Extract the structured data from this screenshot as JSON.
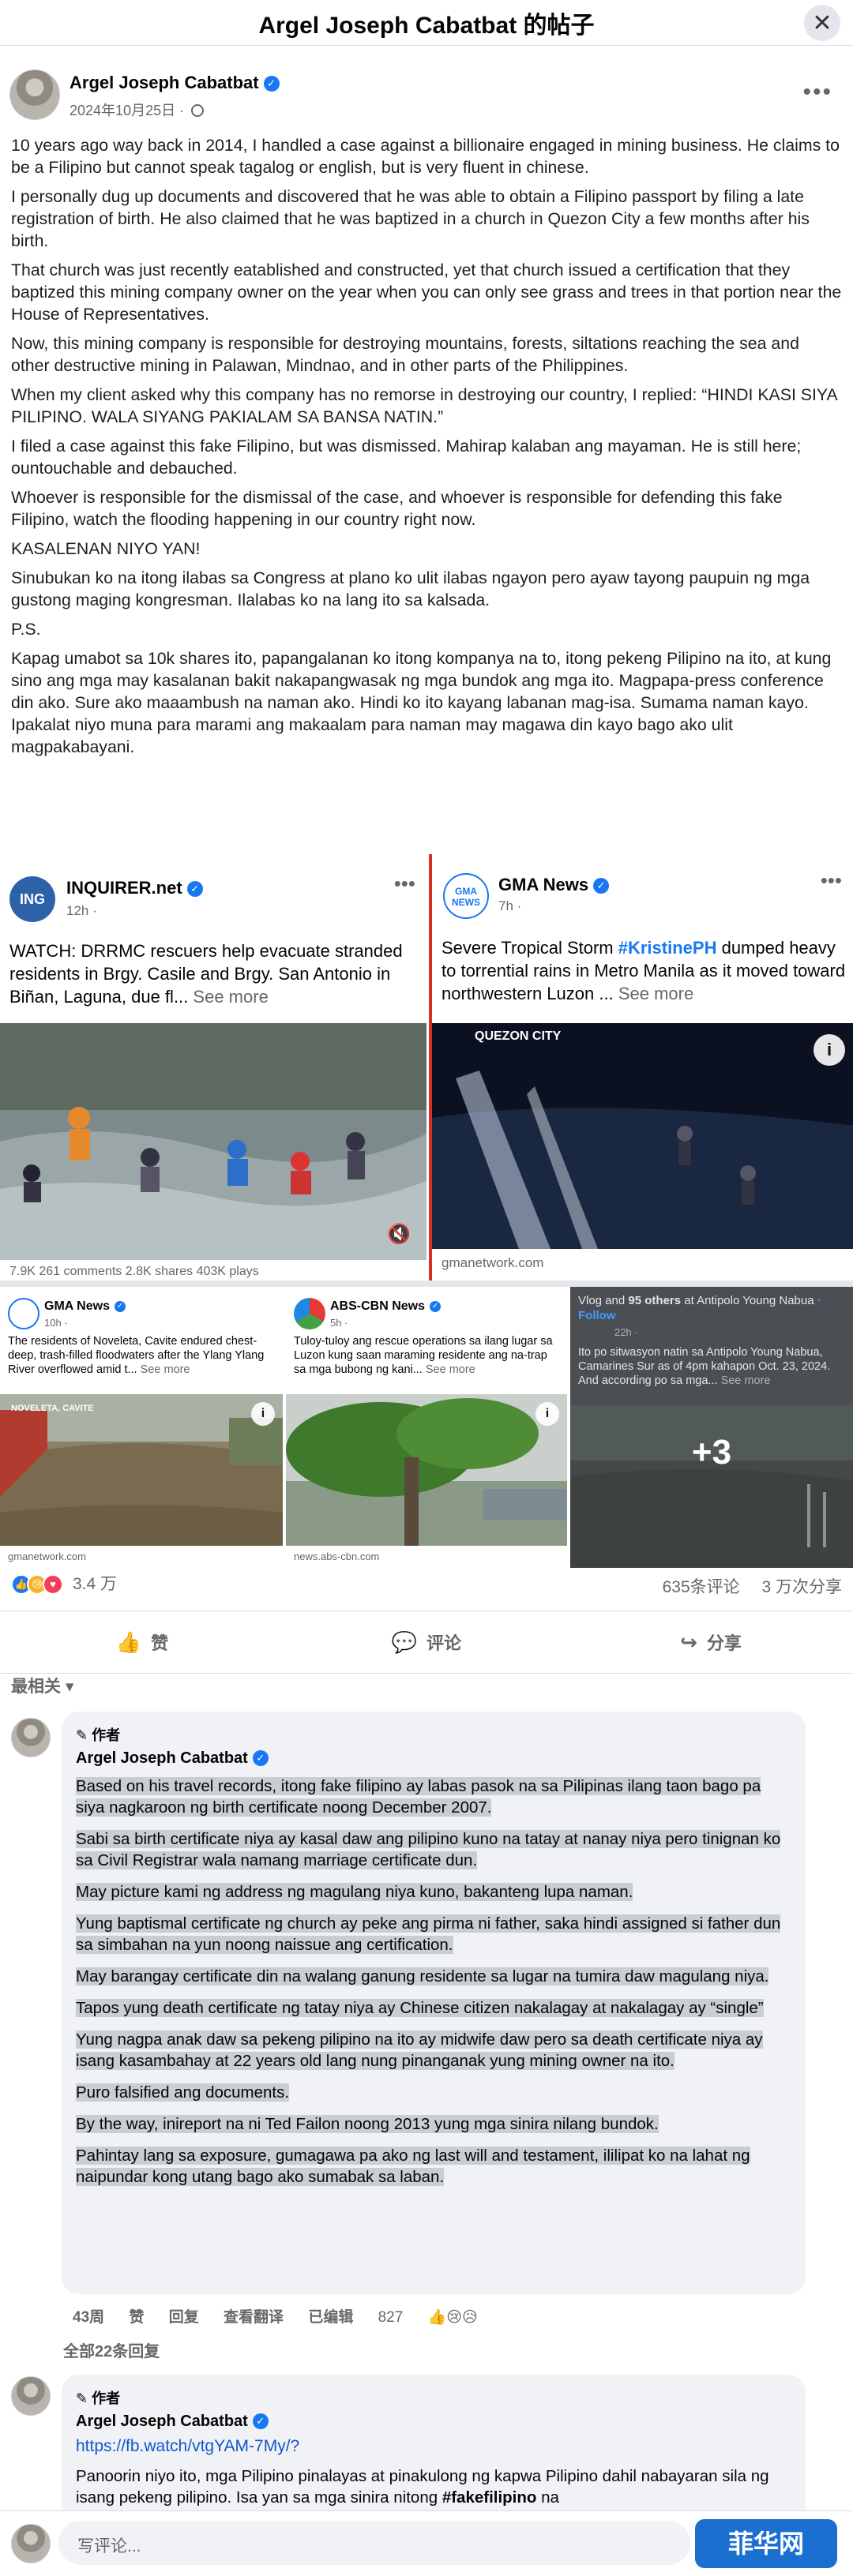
{
  "header": {
    "title": "Argel Joseph Cabatbat 的帖子",
    "close_icon": "close-icon"
  },
  "post": {
    "author": "Argel Joseph Cabatbat",
    "date": "2024年10月25日 ·",
    "paragraphs": [
      "10 years ago way back in 2014, I handled a case against a billionaire engaged in mining business. He claims to be a Filipino but cannot speak tagalog or english, but is very fluent in chinese.",
      "I personally dug up documents and discovered that he was able to obtain a Filipino passport by filing a late registration of birth. He also claimed that he was baptized in a church in Quezon City a few months after his birth.",
      "That church was just recently eatablished and constructed, yet that church issued a certification that they baptized this mining company owner on the year when you can only see grass and trees in that portion near the House of Representatives.",
      "Now, this mining company is responsible for destroying mountains, forests, siltations reaching the sea and other destructive mining in Palawan, Mindnao, and in other parts of the Philippines.",
      "When my client asked why this company has no remorse in destroying our country, I replied: “HINDI KASI SIYA PILIPINO. WALA SIYANG PAKIALAM SA BANSA NATIN.”",
      "I filed a case against this fake Filipino, but was dismissed. Mahirap kalaban ang mayaman. He is still here; ountouchable and debauched.",
      "Whoever is responsible for the dismissal of the case, and whoever is responsible for defending this fake Filipino, watch the flooding happening in our country right now.",
      "KASALENAN  NIYO YAN!",
      "Sinubukan ko na itong ilabas sa Congress at plano ko ulit ilabas ngayon pero ayaw tayong paupuin ng mga gustong maging kongresman. Ilalabas ko na lang ito sa kalsada.",
      "P.S.",
      "Kapag umabot sa 10k shares ito, papangalanan ko itong kompanya na to, itong pekeng Pilipino na ito, at kung sino ang mga may kasalanan bakit nakapangwasak ng mga bundok ang mga ito. Magpapa-press conference din ako. Sure ako maaambush na naman ako. Hindi ko ito kayang labanan mag-isa. Sumama naman kayo. Ipakalat niyo muna para marami ang makaalam para naman may magawa din kayo bago ako ulit magpakabayani."
    ]
  },
  "media": {
    "card1": {
      "source": "INQUIRER.net",
      "logo_text": "ING",
      "time": "12h ·",
      "text": "WATCH: DRRMC rescuers help evacuate stranded residents in Brgy. Casile and Brgy. San Antonio in Biñan, Laguna, due fl...",
      "see_more": "See more",
      "footer": "7.9K    261 comments  2.8K shares  403K plays"
    },
    "card2": {
      "source": "GMA News",
      "logo_text": "GMA NEWS",
      "time": "7h ·",
      "text_pre": "Severe Tropical Storm ",
      "hashtag": "#KristinePH",
      "text_post": " dumped heavy to torrential rains in Metro Manila as it moved toward northwestern Luzon ...",
      "see_more": "See more",
      "photo_label": "QUEZON CITY",
      "footer": "gmanetwork.com"
    },
    "card3": {
      "source": "GMA News",
      "time": "10h ·",
      "text": "The residents of Noveleta, Cavite endured chest-deep, trash-filled floodwaters after the Ylang Ylang River overflowed amid t...",
      "see_more": "See more",
      "photo_label": "NOVELETA, CAVITE",
      "footer": "gmanetwork.com"
    },
    "card4": {
      "source": "ABS-CBN News",
      "time": "5h ·",
      "text": "Tuloy-tuloy ang rescue operations sa ilang lugar sa Luzon kung saan maraming residente ang na-trap sa mga bubong ng kani...",
      "see_more": "See more",
      "footer": "news.abs-cbn.com"
    },
    "card5": {
      "header_pre": "Vlog and ",
      "header_others": "95 others",
      "header_post": " at Antipolo Young Nabua",
      "follow": "· Follow",
      "time": "22h ·",
      "text": "Ito po sitwasyon natin sa Antipolo Young Nabua, Camarines Sur as of 4pm kahapon Oct. 23, 2024. And according po sa mga...",
      "see_more": "See more",
      "more_count": "+3"
    }
  },
  "stats": {
    "reactions": "3.4 万",
    "comments": "635条评论",
    "shares": "3 万次分享"
  },
  "actions": {
    "like": "赞",
    "comment": "评论",
    "share": "分享"
  },
  "filter": "最相关 ▾",
  "comment1": {
    "badge": "✎ 作者",
    "author": "Argel Joseph Cabatbat",
    "paragraphs": [
      "Based on his travel records, itong fake filipino ay labas pasok na sa Pilipinas ilang taon bago pa siya nagkaroon ng birth certificate noong December 2007.",
      "Sabi sa birth certificate niya ay kasal daw ang pilipino kuno na tatay at nanay niya pero tinignan ko sa Civil Registrar wala namang marriage certificate dun.",
      "May picture kami ng address ng magulang niya kuno, bakanteng lupa naman.",
      "Yung baptismal certificate ng church ay peke ang pirma ni father, saka hindi assigned si father dun sa simbahan na yun noong naissue ang certification.",
      "May barangay certificate din na walang ganung residente sa lugar na tumira daw magulang niya.",
      "Tapos yung death certificate ng tatay niya ay Chinese citizen nakalagay at nakalagay ay “single”",
      "Yung nagpa anak daw sa pekeng pilipino na ito ay midwife daw pero sa death certificate niya ay isang kasambahay at 22 years old lang nung pinanganak yung mining owner na ito.",
      "Puro falsified ang documents.",
      "By the way, inireport na ni Ted Failon noong 2013 yung mga sinira nilang bundok.",
      "Pahintay lang sa exposure, gumagawa pa ako ng last will and testament, ililipat ko na lahat ng naipundar kong utang bago ako sumabak sa laban."
    ],
    "time": "43周",
    "like": "赞",
    "reply": "回复",
    "translate": "查看翻译",
    "edited": "已编辑",
    "react_count": "827",
    "all_replies": "全部22条回复"
  },
  "comment2": {
    "badge": "✎ 作者",
    "author": "Argel Joseph Cabatbat",
    "link": "https://fb.watch/vtgYAM-7My/?",
    "text_pre": "Panoorin niyo ito, mga Pilipino pinalayas at pinakulong ng kapwa Pilipino dahil nabayaran sila ng isang pekeng pilipino. Isa yan sa mga sinira nitong ",
    "hashtag": "#fakefilipino",
    "text_post": " na"
  },
  "composer": {
    "placeholder": "写评论...",
    "watermark": "菲华网"
  }
}
